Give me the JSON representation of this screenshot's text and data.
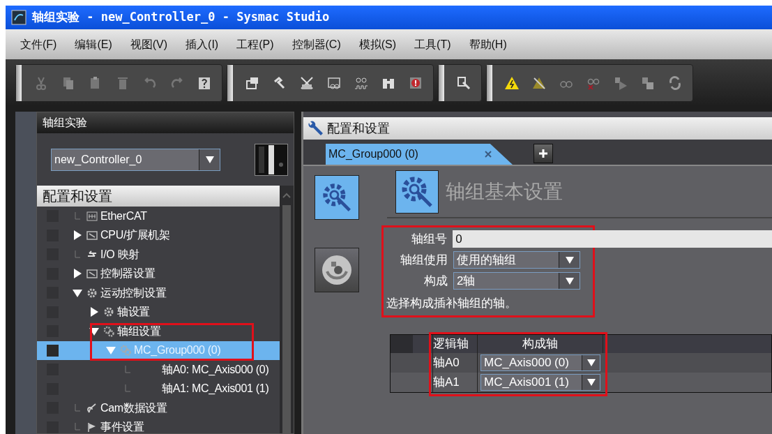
{
  "window": {
    "title": "轴组实验 - new_Controller_0 - Sysmac Studio"
  },
  "menu": [
    "文件(F)",
    "编辑(E)",
    "视图(V)",
    "插入(I)",
    "工程(P)",
    "控制器(C)",
    "模拟(S)",
    "工具(T)",
    "帮助(H)"
  ],
  "sidebar": {
    "title": "轴组实验",
    "controller": "new_Controller_0",
    "section": "配置和设置",
    "tree": [
      {
        "label": "EtherCAT",
        "kind": "leaf",
        "selected": false,
        "highlighted": false
      },
      {
        "label": "CPU/扩展机架",
        "kind": "collapsed",
        "selected": false,
        "highlighted": false
      },
      {
        "label": "I/O 映射",
        "kind": "leaf",
        "selected": false,
        "highlighted": false
      },
      {
        "label": "控制器设置",
        "kind": "collapsed",
        "selected": false,
        "highlighted": false
      },
      {
        "label": "运动控制设置",
        "kind": "expanded",
        "selected": false,
        "highlighted": false,
        "children": [
          {
            "label": "轴设置",
            "kind": "collapsed",
            "selected": false,
            "highlighted": false
          },
          {
            "label": "轴组设置",
            "kind": "expanded",
            "selected": false,
            "highlighted": true,
            "children": [
              {
                "label": "MC_Group000 (0)",
                "kind": "expanded",
                "selected": true,
                "highlighted": false,
                "children": [
                  {
                    "label": "轴A0: MC_Axis000 (0)",
                    "kind": "leaf",
                    "selected": false,
                    "highlighted": false
                  },
                  {
                    "label": "轴A1: MC_Axis001 (1)",
                    "kind": "leaf",
                    "selected": false,
                    "highlighted": false
                  }
                ]
              }
            ]
          }
        ]
      },
      {
        "label": "Cam数据设置",
        "kind": "leaf",
        "selected": false,
        "highlighted": false
      },
      {
        "label": "事件设置",
        "kind": "leaf",
        "selected": false,
        "highlighted": false
      }
    ]
  },
  "editor": {
    "title": "配置和设置",
    "tabs": [
      {
        "label": "MC_Group000 (0)",
        "selected": true
      }
    ],
    "side_buttons": [
      {
        "kind": "gear",
        "selected": true
      },
      {
        "kind": "cam",
        "selected": false
      }
    ],
    "heading": "轴组基本设置",
    "form": {
      "highlighted": true,
      "fields": [
        {
          "label": "轴组号",
          "kind": "text",
          "value": "0"
        },
        {
          "label": "轴组使用",
          "kind": "select",
          "value": "使用的轴组"
        },
        {
          "label": "构成",
          "kind": "select",
          "value": "2轴"
        }
      ],
      "hint": "选择构成插补轴组的轴。"
    },
    "axes_table": {
      "highlighted": true,
      "columns": [
        "逻辑轴",
        "构成轴"
      ],
      "rows": [
        {
          "logical": "轴A0",
          "axis": "MC_Axis000 (0)"
        },
        {
          "logical": "轴A1",
          "axis": "MC_Axis001 (1)"
        }
      ]
    }
  }
}
